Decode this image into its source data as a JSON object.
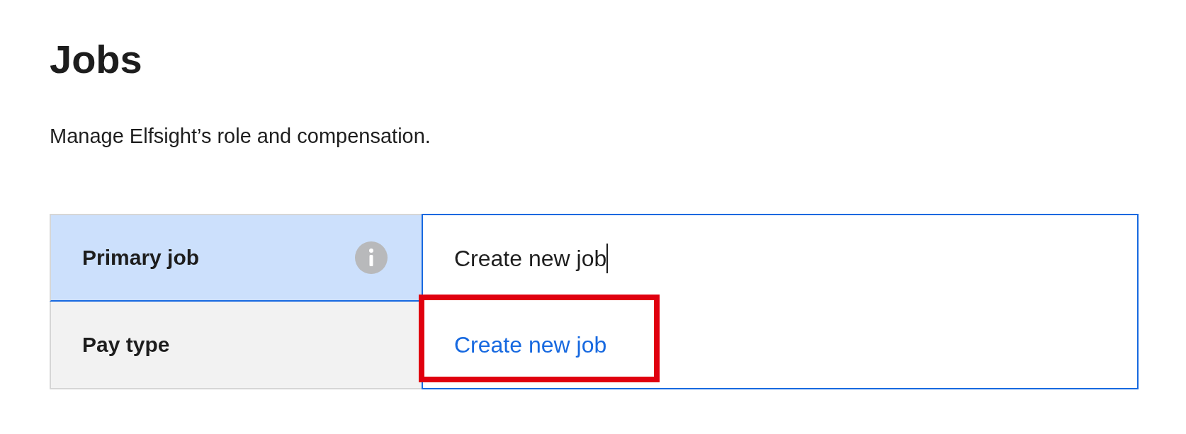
{
  "title": "Jobs",
  "subtitle": "Manage Elfsight’s role and compensation.",
  "rows": [
    {
      "label": "Primary job",
      "info_icon": true,
      "selected": true
    },
    {
      "label": "Pay type",
      "info_icon": false,
      "selected": false
    }
  ],
  "job_field": {
    "value": "Create new job",
    "focused": true,
    "options": [
      {
        "label": "Create new job",
        "highlighted": true
      }
    ]
  }
}
